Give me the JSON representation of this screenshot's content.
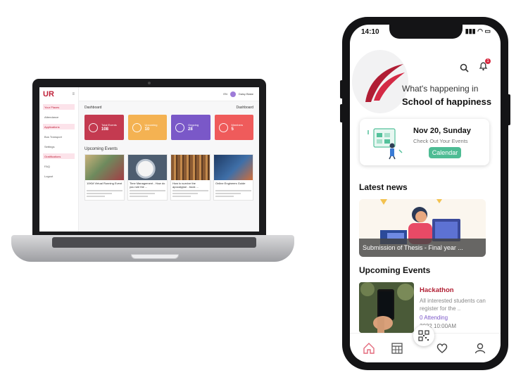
{
  "colors": {
    "brand": "#c0223a",
    "card_red": "#c43a50",
    "card_orange": "#f4b252",
    "card_purple": "#7a58c8",
    "card_coral": "#ef5b5b",
    "calendar_green": "#4ebc94"
  },
  "laptop": {
    "logo": "UR",
    "menu_icon": "≡",
    "nav": [
      {
        "label": "Your Places",
        "active": true
      },
      {
        "label": "Attendance",
        "active": false
      },
      {
        "label": "Applications",
        "active": true
      },
      {
        "label": "Bus Transport",
        "active": false
      },
      {
        "label": "Settings",
        "active": false
      },
      {
        "label": "Gratifications",
        "active": true
      },
      {
        "label": "FAQ",
        "active": false
      },
      {
        "label": "Logout",
        "active": false
      }
    ],
    "topbar": {
      "lang": "EN",
      "user": "Daisy Blake"
    },
    "dashboard_title": "Dashboard",
    "dashboard_right": "Dashboard",
    "stat_cards": [
      {
        "label": "Total Events",
        "value": "108"
      },
      {
        "label": "Upcoming",
        "value": "10"
      },
      {
        "label": "Ongoing",
        "value": "28"
      },
      {
        "label": "Members",
        "value": "5"
      }
    ],
    "upcoming_title": "Upcoming Events",
    "events": [
      {
        "title": "10KM Virtual Running Event"
      },
      {
        "title": "Time Management - How do you rule the ..."
      },
      {
        "title": "How to survive the apocalypse - book ..."
      },
      {
        "title": "Online Engineers Guide"
      }
    ]
  },
  "phone": {
    "time": "14:10",
    "status_icons": "▮▮▮ ◠ ▭",
    "notification_count": "1",
    "greeting": "What's happening in",
    "school": "School of happiness",
    "calendar": {
      "date": "Nov 20, Sunday",
      "subtitle": "Check Out Your Events",
      "button": "Calendar"
    },
    "latest_news_title": "Latest news",
    "news_caption": "Submission of Thesis - Final year ...",
    "upcoming_title": "Upcoming Events",
    "event": {
      "name": "Hackathon",
      "desc": "All interested students can register for the ..",
      "attending": "0 Attending",
      "date": "2022 10:00AM"
    }
  }
}
